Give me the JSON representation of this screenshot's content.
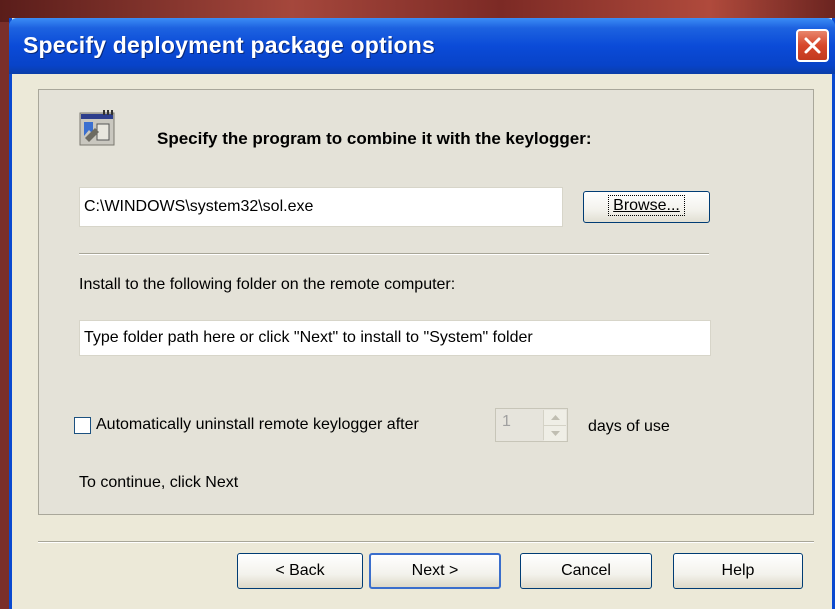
{
  "window": {
    "title": "Specify deployment package options"
  },
  "icons": {
    "close": "close-icon",
    "app": "program-combine-icon",
    "spinner_up": "chevron-up-icon",
    "spinner_down": "chevron-down-icon"
  },
  "program": {
    "heading": "Specify the program to combine it with the keylogger:",
    "path_value": "C:\\WINDOWS\\system32\\sol.exe",
    "browse_label": "Browse..."
  },
  "install": {
    "label": "Install to the following folder on the remote computer:",
    "placeholder": "Type folder path here or click \"Next\" to install to \"System\" folder"
  },
  "uninstall": {
    "checkbox_label": "Automatically uninstall remote keylogger after",
    "checked": false,
    "days_value": "1",
    "days_suffix": "days of use"
  },
  "footer": {
    "continue_text": "To continue, click Next",
    "back_label": "< Back",
    "next_label": "Next >",
    "cancel_label": "Cancel",
    "help_label": "Help"
  },
  "colors": {
    "titlebar": "#0b4bd8",
    "close": "#d7472b",
    "face": "#ece9d8"
  }
}
